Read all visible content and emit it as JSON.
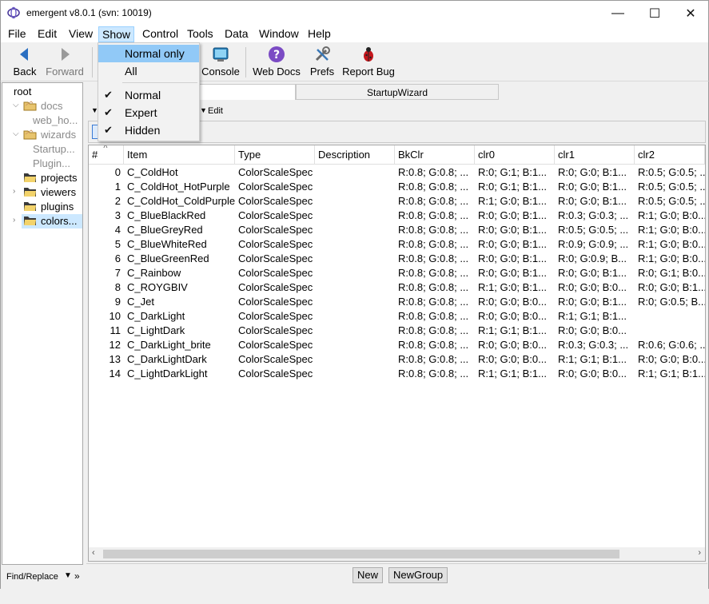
{
  "window": {
    "title": "emergent v8.0.1 (svn: 10019)",
    "min": "—",
    "max": "☐",
    "close": "✕"
  },
  "menu": {
    "items": [
      {
        "label": "File",
        "underline": "F"
      },
      {
        "label": "Edit",
        "underline": "E"
      },
      {
        "label": "View",
        "underline": "V"
      },
      {
        "label": "Show",
        "underline": "S"
      },
      {
        "label": "Control",
        "underline": "C"
      },
      {
        "label": "Tools",
        "underline": "T"
      },
      {
        "label": "Data",
        "underline": "D"
      },
      {
        "label": "Window",
        "underline": "W"
      },
      {
        "label": "Help",
        "underline": "H"
      }
    ]
  },
  "toolbar": {
    "back": "Back",
    "forward": "Forward",
    "console": "Console",
    "webdocs": "Web Docs",
    "prefs": "Prefs",
    "reportbug": "Report Bug"
  },
  "show_menu": {
    "normal_only": "Normal only",
    "all": "All",
    "normal": "Normal",
    "expert": "Expert",
    "hidden": "Hidden"
  },
  "tree": {
    "root": "root",
    "docs": "docs",
    "web_ho": "web_ho...",
    "wizards": "wizards",
    "startup": "Startup...",
    "plugin": "Plugin...",
    "projects": "projects",
    "viewers": "viewers",
    "plugins": "plugins",
    "colors": "colors..."
  },
  "findbar": {
    "label": "Find/Replace"
  },
  "tabs": {
    "startup_wizard": "StartupWizard"
  },
  "subbar": {
    "edit": "Edit"
  },
  "table": {
    "headers": [
      "#",
      "Item",
      "Type",
      "Description",
      "BkClr",
      "clr0",
      "clr1",
      "clr2"
    ],
    "rows": [
      [
        "0",
        "C_ColdHot",
        "ColorScaleSpec",
        "",
        "R:0.8; G:0.8; ...",
        "R:0; G:1; B:1...",
        "R:0; G:0; B:1...",
        "R:0.5; G:0.5; ..."
      ],
      [
        "1",
        "C_ColdHot_HotPurple",
        "ColorScaleSpec",
        "",
        "R:0.8; G:0.8; ...",
        "R:0; G:1; B:1...",
        "R:0; G:0; B:1...",
        "R:0.5; G:0.5; ..."
      ],
      [
        "2",
        "C_ColdHot_ColdPurple",
        "ColorScaleSpec",
        "",
        "R:0.8; G:0.8; ...",
        "R:1; G:0; B:1...",
        "R:0; G:0; B:1...",
        "R:0.5; G:0.5; ..."
      ],
      [
        "3",
        "C_BlueBlackRed",
        "ColorScaleSpec",
        "",
        "R:0.8; G:0.8; ...",
        "R:0; G:0; B:1...",
        "R:0.3; G:0.3; ...",
        "R:1; G:0; B:0..."
      ],
      [
        "4",
        "C_BlueGreyRed",
        "ColorScaleSpec",
        "",
        "R:0.8; G:0.8; ...",
        "R:0; G:0; B:1...",
        "R:0.5; G:0.5; ...",
        "R:1; G:0; B:0..."
      ],
      [
        "5",
        "C_BlueWhiteRed",
        "ColorScaleSpec",
        "",
        "R:0.8; G:0.8; ...",
        "R:0; G:0; B:1...",
        "R:0.9; G:0.9; ...",
        "R:1; G:0; B:0..."
      ],
      [
        "6",
        "C_BlueGreenRed",
        "ColorScaleSpec",
        "",
        "R:0.8; G:0.8; ...",
        "R:0; G:0; B:1...",
        "R:0; G:0.9; B...",
        "R:1; G:0; B:0..."
      ],
      [
        "7",
        "C_Rainbow",
        "ColorScaleSpec",
        "",
        "R:0.8; G:0.8; ...",
        "R:0; G:0; B:1...",
        "R:0; G:0; B:1...",
        "R:0; G:1; B:0..."
      ],
      [
        "8",
        "C_ROYGBIV",
        "ColorScaleSpec",
        "",
        "R:0.8; G:0.8; ...",
        "R:1; G:0; B:1...",
        "R:0; G:0; B:0...",
        "R:0; G:0; B:1..."
      ],
      [
        "9",
        "C_Jet",
        "ColorScaleSpec",
        "",
        "R:0.8; G:0.8; ...",
        "R:0; G:0; B:0...",
        "R:0; G:0; B:1...",
        "R:0; G:0.5; B..."
      ],
      [
        "10",
        "C_DarkLight",
        "ColorScaleSpec",
        "",
        "R:0.8; G:0.8; ...",
        "R:0; G:0; B:0...",
        "R:1; G:1; B:1...",
        ""
      ],
      [
        "11",
        "C_LightDark",
        "ColorScaleSpec",
        "",
        "R:0.8; G:0.8; ...",
        "R:1; G:1; B:1...",
        "R:0; G:0; B:0...",
        ""
      ],
      [
        "12",
        "C_DarkLight_brite",
        "ColorScaleSpec",
        "",
        "R:0.8; G:0.8; ...",
        "R:0; G:0; B:0...",
        "R:0.3; G:0.3; ...",
        "R:0.6; G:0.6; ..."
      ],
      [
        "13",
        "C_DarkLightDark",
        "ColorScaleSpec",
        "",
        "R:0.8; G:0.8; ...",
        "R:0; G:0; B:0...",
        "R:1; G:1; B:1...",
        "R:0; G:0; B:0..."
      ],
      [
        "14",
        "C_LightDarkLight",
        "ColorScaleSpec",
        "",
        "R:0.8; G:0.8; ...",
        "R:1; G:1; B:1...",
        "R:0; G:0; B:0...",
        "R:1; G:1; B:1..."
      ]
    ]
  },
  "buttons": {
    "new": "New",
    "newgroup": "NewGroup"
  },
  "colors": {
    "accent": "#cce8ff",
    "menu_highlight": "#91c9f7",
    "back_arrow": "#2b6fc1"
  },
  "icons": [
    "app-icon",
    "back-arrow-icon",
    "forward-arrow-icon",
    "console-icon",
    "help-icon",
    "prefs-tools-icon",
    "bug-icon",
    "folder-icon",
    "check-icon"
  ]
}
